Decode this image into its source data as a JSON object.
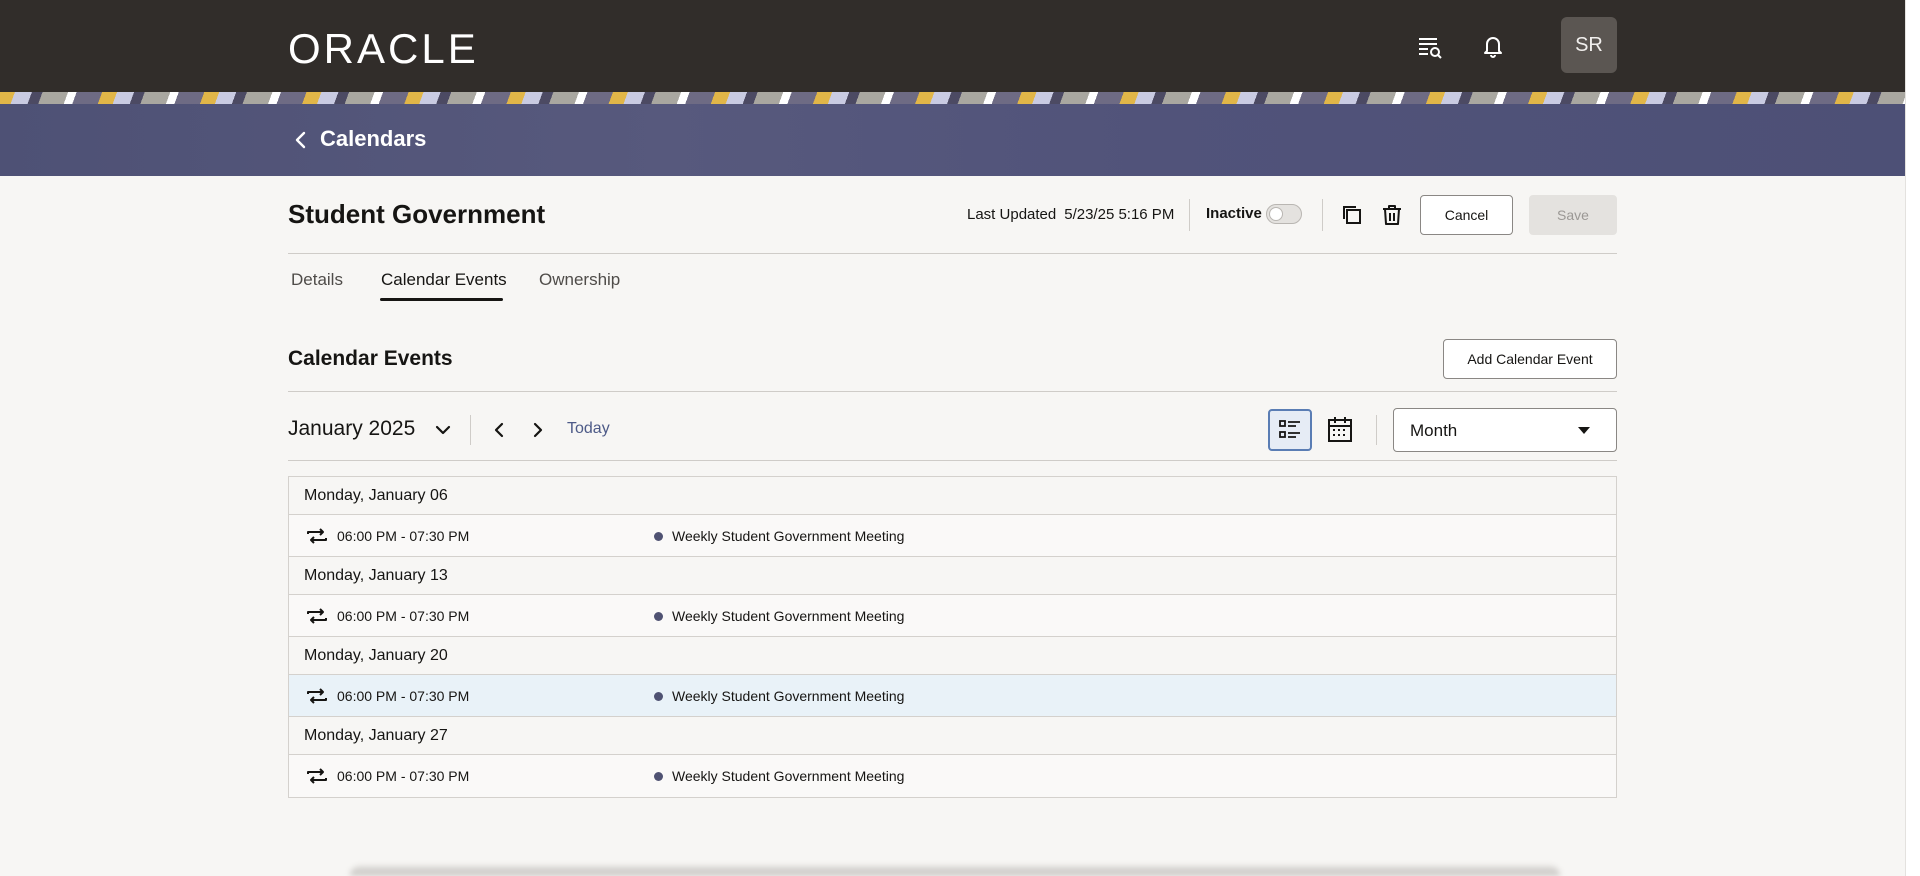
{
  "header": {
    "logo": "ORACLE",
    "avatar_initials": "SR",
    "icons": [
      "search-list-icon",
      "bell-icon"
    ]
  },
  "banner": {
    "title": "Calendars"
  },
  "record": {
    "title": "Student Government",
    "last_updated_label": "Last Updated",
    "last_updated_value": "5/23/25 5:16 PM",
    "inactive_label": "Inactive",
    "inactive_on": false,
    "cancel_label": "Cancel",
    "save_label": "Save"
  },
  "tabs": [
    {
      "label": "Details",
      "active": false
    },
    {
      "label": "Calendar Events",
      "active": true
    },
    {
      "label": "Ownership",
      "active": false
    }
  ],
  "section": {
    "title": "Calendar Events",
    "add_button": "Add Calendar Event"
  },
  "toolbar": {
    "month": "January 2025",
    "today": "Today",
    "view_select": "Month"
  },
  "days": [
    {
      "date": "Monday, January 06",
      "events": [
        {
          "time": "06:00 PM - 07:30 PM",
          "title": "Weekly Student Government Meeting"
        }
      ]
    },
    {
      "date": "Monday, January 13",
      "events": [
        {
          "time": "06:00 PM - 07:30 PM",
          "title": "Weekly Student Government Meeting"
        }
      ]
    },
    {
      "date": "Monday, January 20",
      "events": [
        {
          "time": "06:00 PM - 07:30 PM",
          "title": "Weekly Student Government Meeting"
        }
      ]
    },
    {
      "date": "Monday, January 27",
      "events": [
        {
          "time": "06:00 PM - 07:30 PM",
          "title": "Weekly Student Government Meeting"
        }
      ]
    }
  ],
  "colors": {
    "header_bg": "#312d2a",
    "banner_bg": "#51537a",
    "event_dot": "#4f5272",
    "link": "#4d5a87",
    "row_highlight": "#e9f2f8"
  }
}
